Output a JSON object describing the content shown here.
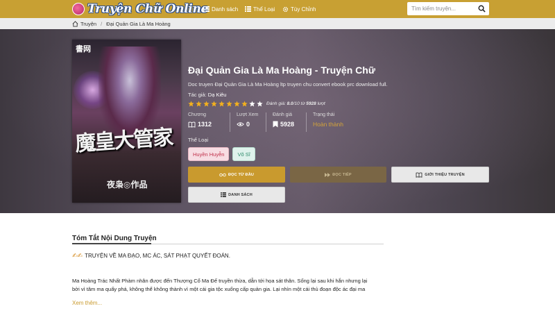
{
  "header": {
    "logo_text": "Truyện Chữ Online",
    "nav": [
      {
        "label": "Danh sách",
        "icon": "list-icon"
      },
      {
        "label": "Thể Loại",
        "icon": "list-icon"
      },
      {
        "label": "Tùy Chỉnh",
        "icon": "gear-icon"
      }
    ],
    "search_placeholder": "Tìm kiếm truyện...",
    "accent": "#c8a033"
  },
  "breadcrumb": {
    "home": "Truyện",
    "current": "Đại Quản Gia Là Ma Hoàng"
  },
  "cover": {
    "publisher": "書网",
    "title_art": "魔皇大管家",
    "author_art": "夜枭◎作品"
  },
  "book": {
    "title": "Đại Quản Gia Là Ma Hoàng - Truyện Chữ",
    "description": "Doc truyen Đại Quản Gia Là Ma Hoàng ltp truyen chu convert ebook prc download full.",
    "author_label": "Tác giả:",
    "author_name": "Dạ Kiêu",
    "rating_stars_filled": 8,
    "rating_stars_total": 10,
    "rating_prefix": "Đánh giá:",
    "rating_value": "8.0",
    "rating_mid": "/10 từ",
    "rating_count": "5928",
    "rating_suffix": "lượt",
    "stats": {
      "chapters_label": "Chương",
      "chapters_value": "1312",
      "views_label": "Lượt Xem",
      "views_value": "0",
      "ratings_label": "Đánh giá",
      "ratings_value": "5928",
      "status_label": "Trạng thái",
      "status_value": "Hoàn thành"
    },
    "genre_label": "Thể Loại",
    "genres": [
      "Huyền Huyễn",
      "Võ Sĩ"
    ]
  },
  "buttons": {
    "read_start": "ĐỌC TỪ ĐẦU",
    "continue": "ĐỌC TIẾP",
    "intro": "GIỚI THIỆU TRUYỆN",
    "list": "DANH SÁCH"
  },
  "summary": {
    "heading": "Tóm Tắt Nội Dung Truyện",
    "tagline": "TRUYỆN VỀ MA ĐẠO, MC ÁC, SÁT PHẠT QUYẾT ĐOÁN.",
    "para_line1": "Ma Hoàng Trác Nhất Phàm nhân được đến Thượng Cổ Ma Đế truyền thừa, dẫn tới họa sát thân. Sống lại sau khi hắn nhưng lại",
    "para_line2": "bởi vì tâm ma quấy phá, không thể không thành vì một cái gia tộc xuống cấp quản gia. Lại nhìn một cái thủ đoạn độc ác đại ma",
    "more": "Xem thêm..."
  }
}
